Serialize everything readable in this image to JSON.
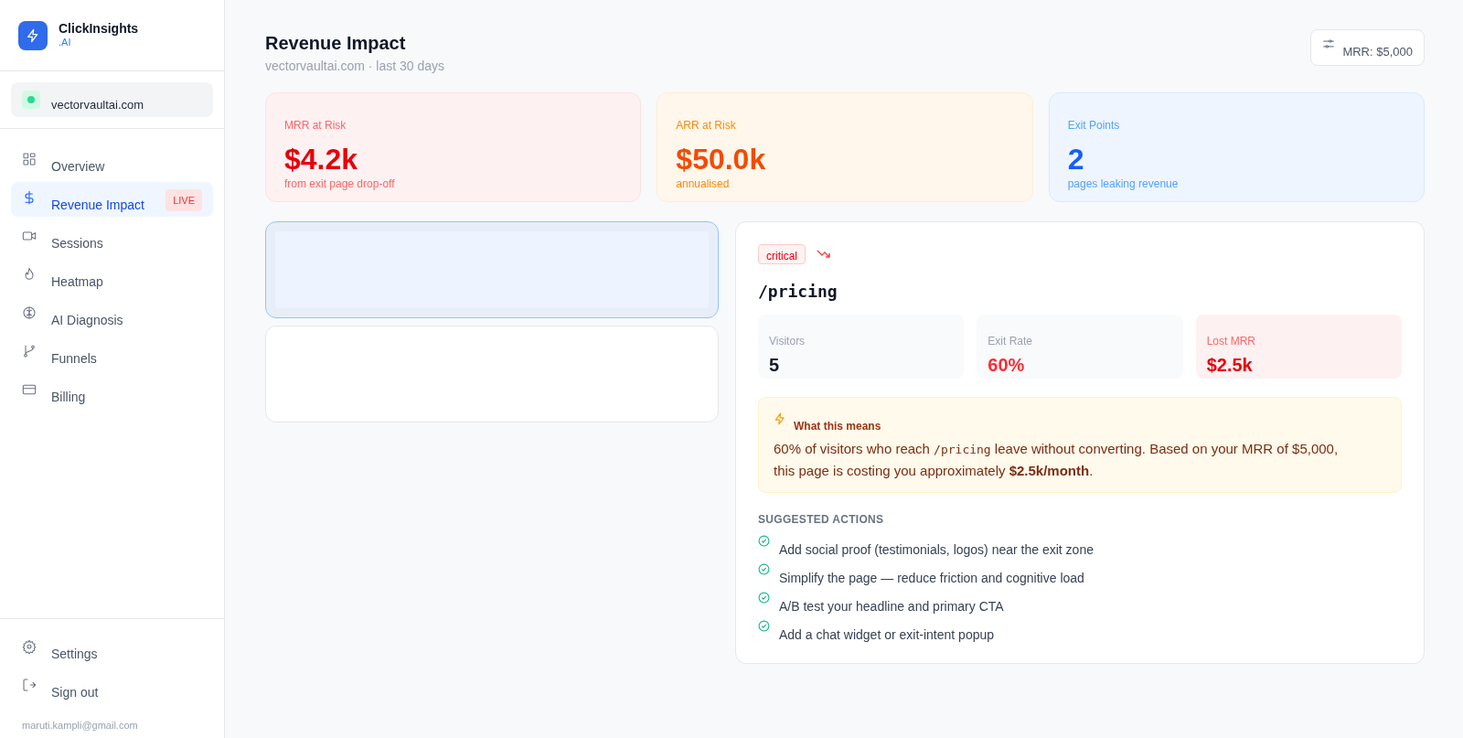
{
  "brand": {
    "name": "ClickInsights",
    "suffix": ".AI"
  },
  "site": {
    "domain": "vectorvaultai.com"
  },
  "nav": [
    {
      "label": "Overview",
      "selected": false
    },
    {
      "label": "Revenue Impact",
      "selected": true,
      "badge": "LIVE"
    },
    {
      "label": "Sessions",
      "selected": false
    },
    {
      "label": "Heatmap",
      "selected": false
    },
    {
      "label": "AI Diagnosis",
      "selected": false
    },
    {
      "label": "Funnels",
      "selected": false
    },
    {
      "label": "Billing",
      "selected": false
    }
  ],
  "footer_nav": [
    {
      "label": "Settings"
    },
    {
      "label": "Sign out"
    }
  ],
  "user_email": "maruti.kampli@gmail.com",
  "header": {
    "title": "Revenue Impact",
    "subtitle": "vectorvaultai.com · last 30 days",
    "mrr_button": "MRR: $5,000"
  },
  "stats": [
    {
      "kind": "red",
      "label": "MRR at Risk",
      "value": "$4.2k",
      "note": "from exit page drop-off"
    },
    {
      "kind": "orange",
      "label": "ARR at Risk",
      "value": "$50.0k",
      "note": "annualised"
    },
    {
      "kind": "blue",
      "label": "Exit Points",
      "value": "2",
      "note": "pages leaking revenue"
    }
  ],
  "exit_pages": [
    {
      "selected": true
    },
    {
      "selected": false
    }
  ],
  "detail": {
    "severity": "critical",
    "path": "/pricing",
    "metrics": [
      {
        "kind": "neutral",
        "label": "Visitors",
        "value": "5"
      },
      {
        "kind": "alert",
        "label": "Exit Rate",
        "value": "60%"
      },
      {
        "kind": "loss",
        "label": "Lost MRR",
        "value": "$2.5k"
      }
    ],
    "insight": {
      "title": "What this means",
      "parts": [
        {
          "kind": "text",
          "text": "60% of visitors who reach "
        },
        {
          "kind": "code",
          "text": "/pricing"
        },
        {
          "kind": "text",
          "text": " leave without converting. Based on your MRR of $5,000, this page is costing you approximately **$2.5k/month**."
        }
      ]
    },
    "actions": {
      "title": "SUGGESTED ACTIONS",
      "items": [
        "Add social proof (testimonials, logos) near the exit zone",
        "Simplify the page — reduce friction and cognitive load",
        "A/B test your headline and primary CTA",
        "Add a chat widget or exit-intent popup"
      ]
    }
  }
}
